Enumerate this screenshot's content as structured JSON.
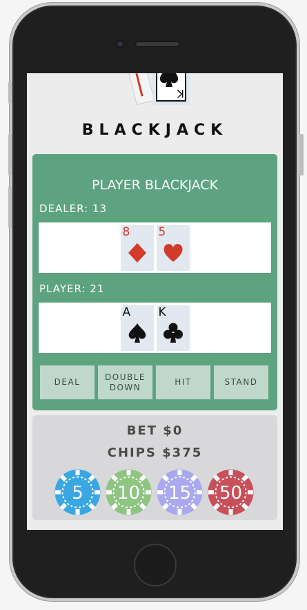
{
  "game": {
    "title": "BLACKJACK",
    "status": "PLAYER BLACKJACK",
    "dealer": {
      "label": "DEALER: 13",
      "cards": [
        {
          "rank": "8",
          "suit": "diamonds"
        },
        {
          "rank": "5",
          "suit": "hearts"
        }
      ]
    },
    "player": {
      "label": "PLAYER: 21",
      "cards": [
        {
          "rank": "A",
          "suit": "spades"
        },
        {
          "rank": "K",
          "suit": "clubs"
        }
      ]
    }
  },
  "actions": {
    "deal": "DEAL",
    "double_down_line1": "DOUBLE",
    "double_down_line2": "DOWN",
    "hit": "HIT",
    "stand": "STAND"
  },
  "bank": {
    "bet": "BET $0",
    "chips": "CHIPS $375"
  },
  "chips": [
    {
      "value": "5",
      "color": "#3aa7e3"
    },
    {
      "value": "10",
      "color": "#8fc483"
    },
    {
      "value": "15",
      "color": "#a9a9f0"
    },
    {
      "value": "50",
      "color": "#c8505a"
    }
  ],
  "colors": {
    "table": "#5da37f",
    "button": "#c0d8cc",
    "red_suit": "#d23a2a"
  }
}
